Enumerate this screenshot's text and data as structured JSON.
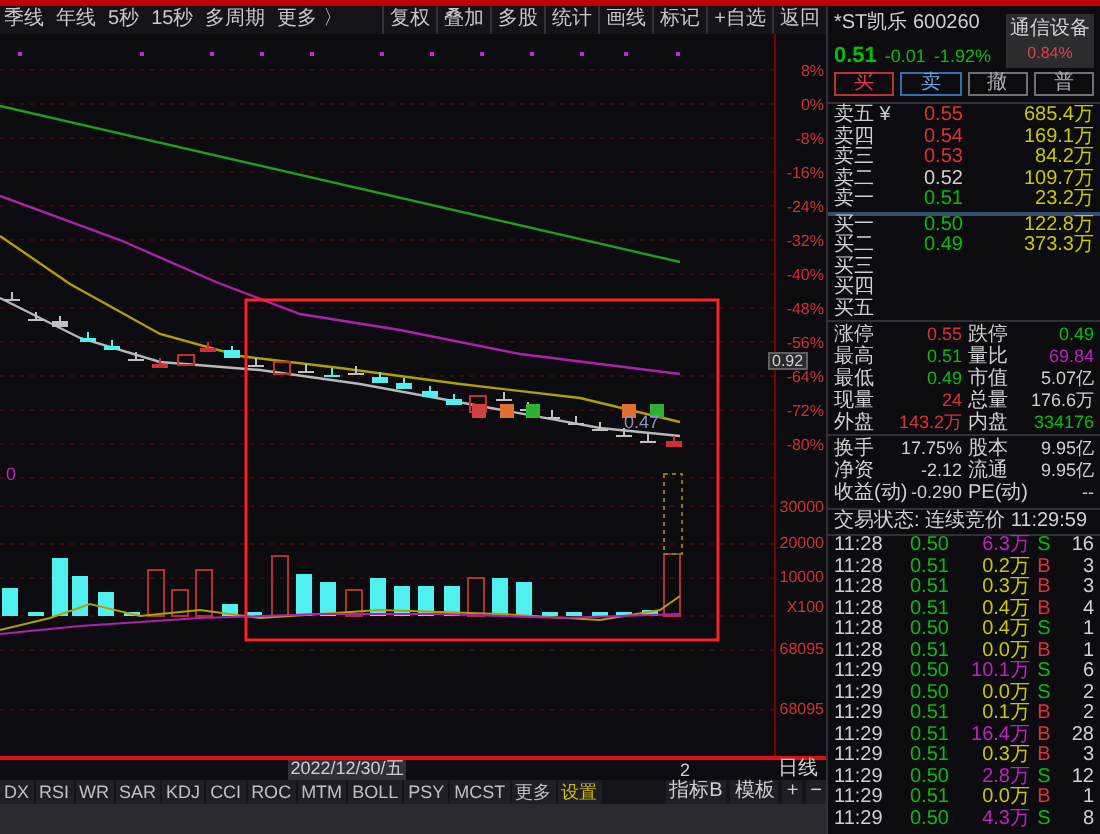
{
  "toolbar": {
    "periods": [
      "季线",
      "年线",
      "5秒",
      "15秒",
      "多周期",
      "更多 〉"
    ],
    "tools": [
      "复权",
      "叠加",
      "多股",
      "统计",
      "画线",
      "标记",
      "+自选",
      "返回"
    ]
  },
  "chart": {
    "price_axis": [
      "8%",
      "0%",
      "-8%",
      "-16%",
      "-24%",
      "-32%",
      "-40%",
      "-48%",
      "-56%",
      "-64%",
      "-72%",
      "-80%"
    ],
    "price_tag": "0.92",
    "last_price_label": "0.47",
    "indicator_value": "0",
    "volume_axis": [
      "30000",
      "20000",
      "10000",
      "X100"
    ],
    "lower_axis": [
      "68095",
      "68095"
    ],
    "date": "2022/12/30/五",
    "cursor_label": "2",
    "period": "日线"
  },
  "indicator_tabs": [
    {
      "label": "DX",
      "kind": "tab"
    },
    {
      "label": "RSI",
      "kind": "tab"
    },
    {
      "label": "WR",
      "kind": "tab"
    },
    {
      "label": "SAR",
      "kind": "tab"
    },
    {
      "label": "KDJ",
      "kind": "tab"
    },
    {
      "label": "CCI",
      "kind": "tab"
    },
    {
      "label": "ROC",
      "kind": "tab"
    },
    {
      "label": "MTM",
      "kind": "tab"
    },
    {
      "label": "BOLL",
      "kind": "tab"
    },
    {
      "label": "PSY",
      "kind": "tab"
    },
    {
      "label": "MCST",
      "kind": "tab"
    },
    {
      "label": "更多",
      "kind": "tab"
    },
    {
      "label": "设置",
      "kind": "settings"
    }
  ],
  "template_tabs": [
    "指标B",
    "模板",
    "+",
    "−"
  ],
  "quote": {
    "title": "*ST凯乐 600260",
    "price": "0.51",
    "change": "-0.01",
    "change_pct": "-1.92%",
    "sector": {
      "name": "通信设备",
      "change": "0.84%"
    },
    "actions": [
      "买",
      "卖",
      "撤",
      "普"
    ],
    "sell_orders": [
      {
        "label": "卖五 ¥",
        "price": "0.55",
        "volume": "685.4万",
        "color": "#e03030"
      },
      {
        "label": "卖四",
        "price": "0.54",
        "volume": "169.1万",
        "color": "#e03030"
      },
      {
        "label": "卖三",
        "price": "0.53",
        "volume": "84.2万",
        "color": "#e03030"
      },
      {
        "label": "卖二",
        "price": "0.52",
        "volume": "109.7万",
        "color": "#d0d0d0"
      },
      {
        "label": "卖一",
        "price": "0.51",
        "volume": "23.2万",
        "color": "#00c000"
      }
    ],
    "buy_orders": [
      {
        "label": "买一",
        "price": "0.50",
        "volume": "122.8万",
        "color": "#00c000"
      },
      {
        "label": "买二",
        "price": "0.49",
        "volume": "373.3万",
        "color": "#00c000"
      },
      {
        "label": "买三"
      },
      {
        "label": "买四"
      },
      {
        "label": "买五"
      }
    ],
    "stats": [
      [
        {
          "label": "涨停",
          "value": "0.55",
          "color": "#e03030"
        },
        {
          "label": "跌停",
          "value": "0.49",
          "color": "#00c000"
        }
      ],
      [
        {
          "label": "最高",
          "value": "0.51",
          "color": "#00c000"
        },
        {
          "label": "量比",
          "value": "69.84",
          "color": "#c020c0"
        }
      ],
      [
        {
          "label": "最低",
          "value": "0.49",
          "color": "#00c000"
        },
        {
          "label": "市值",
          "value": "5.07亿",
          "color": "#d0d0d0"
        }
      ],
      [
        {
          "label": "现量",
          "value": "24",
          "color": "#e03030"
        },
        {
          "label": "总量",
          "value": "176.6万",
          "color": "#d0d0d0"
        }
      ],
      [
        {
          "label": "外盘",
          "value": "143.2万",
          "color": "#e03030"
        },
        {
          "label": "内盘",
          "value": "334176",
          "color": "#00c000"
        }
      ]
    ],
    "stats2": [
      [
        {
          "label": "换手",
          "value": "17.75%"
        },
        {
          "label": "股本",
          "value": "9.95亿"
        }
      ],
      [
        {
          "label": "净资",
          "value": "-2.12"
        },
        {
          "label": "流通",
          "value": "9.95亿"
        }
      ],
      [
        {
          "label": "收益(动)",
          "value": "-0.290"
        },
        {
          "label": "PE(动)",
          "value": "--"
        }
      ]
    ],
    "status": "交易状态: 连续竞价 11:29:59",
    "ticks": [
      {
        "time": "11:28",
        "price": {
          "text": "0.50",
          "color": "#00c000"
        },
        "volume": {
          "text": "6.3万",
          "color": "#c020c0"
        },
        "side": {
          "text": "S",
          "color": "#00c000"
        },
        "count": "16"
      },
      {
        "time": "11:28",
        "price": {
          "text": "0.51",
          "color": "#00c000"
        },
        "volume": {
          "text": "0.2万",
          "color": "#c8c800"
        },
        "side": {
          "text": "B",
          "color": "#e03030"
        },
        "count": "3"
      },
      {
        "time": "11:28",
        "price": {
          "text": "0.51",
          "color": "#00c000"
        },
        "volume": {
          "text": "0.3万",
          "color": "#c8c800"
        },
        "side": {
          "text": "B",
          "color": "#e03030"
        },
        "count": "3"
      },
      {
        "time": "11:28",
        "price": {
          "text": "0.51",
          "color": "#00c000"
        },
        "volume": {
          "text": "0.4万",
          "color": "#c8c800"
        },
        "side": {
          "text": "B",
          "color": "#e03030"
        },
        "count": "4"
      },
      {
        "time": "11:28",
        "price": {
          "text": "0.50",
          "color": "#00c000"
        },
        "volume": {
          "text": "0.4万",
          "color": "#c8c800"
        },
        "side": {
          "text": "S",
          "color": "#00c000"
        },
        "count": "1"
      },
      {
        "time": "11:28",
        "price": {
          "text": "0.51",
          "color": "#00c000"
        },
        "volume": {
          "text": "0.0万",
          "color": "#c8c800"
        },
        "side": {
          "text": "B",
          "color": "#e03030"
        },
        "count": "1"
      },
      {
        "time": "11:29",
        "price": {
          "text": "0.50",
          "color": "#00c000"
        },
        "volume": {
          "text": "10.1万",
          "color": "#c020c0"
        },
        "side": {
          "text": "S",
          "color": "#00c000"
        },
        "count": "6"
      },
      {
        "time": "11:29",
        "price": {
          "text": "0.50",
          "color": "#00c000"
        },
        "volume": {
          "text": "0.0万",
          "color": "#c8c800"
        },
        "side": {
          "text": "S",
          "color": "#00c000"
        },
        "count": "2"
      },
      {
        "time": "11:29",
        "price": {
          "text": "0.51",
          "color": "#00c000"
        },
        "volume": {
          "text": "0.1万",
          "color": "#c8c800"
        },
        "side": {
          "text": "B",
          "color": "#e03030"
        },
        "count": "2"
      },
      {
        "time": "11:29",
        "price": {
          "text": "0.51",
          "color": "#00c000"
        },
        "volume": {
          "text": "16.4万",
          "color": "#c020c0"
        },
        "side": {
          "text": "B",
          "color": "#e03030"
        },
        "count": "28"
      },
      {
        "time": "11:29",
        "price": {
          "text": "0.51",
          "color": "#00c000"
        },
        "volume": {
          "text": "0.3万",
          "color": "#c8c800"
        },
        "side": {
          "text": "B",
          "color": "#e03030"
        },
        "count": "3"
      },
      {
        "time": "11:29",
        "price": {
          "text": "0.50",
          "color": "#00c000"
        },
        "volume": {
          "text": "2.8万",
          "color": "#c020c0"
        },
        "side": {
          "text": "S",
          "color": "#00c000"
        },
        "count": "12"
      },
      {
        "time": "11:29",
        "price": {
          "text": "0.51",
          "color": "#00c000"
        },
        "volume": {
          "text": "0.0万",
          "color": "#c8c800"
        },
        "side": {
          "text": "B",
          "color": "#e03030"
        },
        "count": "1"
      },
      {
        "time": "11:29",
        "price": {
          "text": "0.50",
          "color": "#00c000"
        },
        "volume": {
          "text": "4.3万",
          "color": "#c020c0"
        },
        "side": {
          "text": "S",
          "color": "#00c000"
        },
        "count": "8"
      }
    ]
  }
}
